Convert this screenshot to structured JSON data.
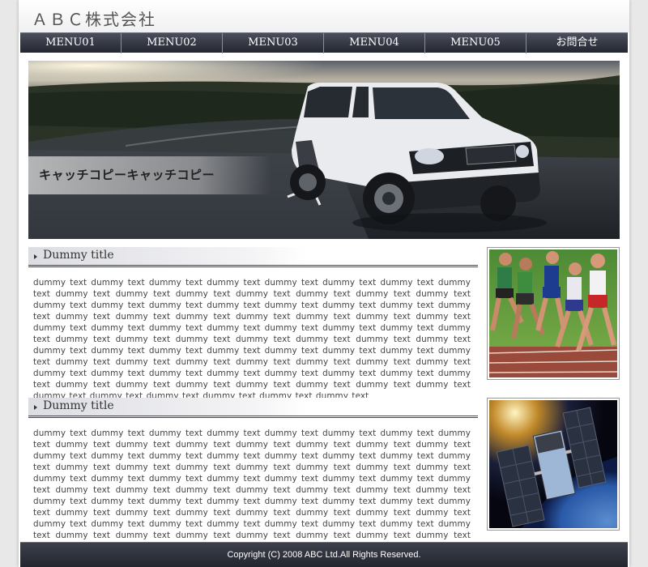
{
  "header": {
    "logo": "ＡＢＣ株式会社"
  },
  "nav": {
    "items": [
      {
        "label": "MENU01"
      },
      {
        "label": "MENU02"
      },
      {
        "label": "MENU03"
      },
      {
        "label": "MENU04"
      },
      {
        "label": "MENU05"
      },
      {
        "label": "お問合せ"
      }
    ]
  },
  "hero": {
    "catch_copy": "キャッチコピーキャッチコピー"
  },
  "sections": [
    {
      "title": "Dummy title",
      "body": "dummy text dummy text dummy text dummy text dummy text dummy text dummy text dummy text dummy text dummy text dummy text dummy text dummy text dummy text dummy text dummy text dummy text dummy text dummy text dummy text dummy text dummy text dummy text dummy text dummy text dummy text dummy text dummy text dummy text dummy text dummy text dummy text dummy text dummy text dummy text dummy text dummy text dummy text dummy text dummy text dummy text dummy text dummy text dummy text dummy text dummy text dummy text dummy text dummy text dummy text dummy text dummy text dummy text dummy text dummy text dummy text dummy text dummy text dummy text dummy text dummy text dummy text dummy text dummy text dummy text dummy text dummy text dummy text dummy text dummy text dummy text dummy text dummy text dummy text dummy text dummy text dummy text dummy text dummy text dummy text dummy text"
    },
    {
      "title": "Dummy title",
      "body": "dummy text dummy text dummy text dummy text dummy text dummy text dummy text dummy text dummy text dummy text dummy text dummy text dummy text dummy text dummy text dummy text dummy text dummy text dummy text dummy text dummy text dummy text dummy text dummy text dummy text dummy text dummy text dummy text dummy text dummy text dummy text dummy text dummy text dummy text dummy text dummy text dummy text dummy text dummy text dummy text dummy text dummy text dummy text dummy text dummy text dummy text dummy text dummy text dummy text dummy text dummy text dummy text dummy text dummy text dummy text dummy text dummy text dummy text dummy text dummy text dummy text dummy text dummy text dummy text dummy text dummy text dummy text dummy text dummy text dummy text dummy text dummy text dummy text dummy text dummy text dummy text dummy text dummy text dummy text dummy text dummy text dummy text dummy text dummy text dummy text dummy text"
    }
  ],
  "footer": {
    "copyright": "Copyright (C) 2008 ABC Ltd.All Rights Reserved."
  },
  "colors": {
    "nav_dark": "#23262f",
    "footer_dark": "#23262e",
    "title_rule": "#444a57"
  }
}
